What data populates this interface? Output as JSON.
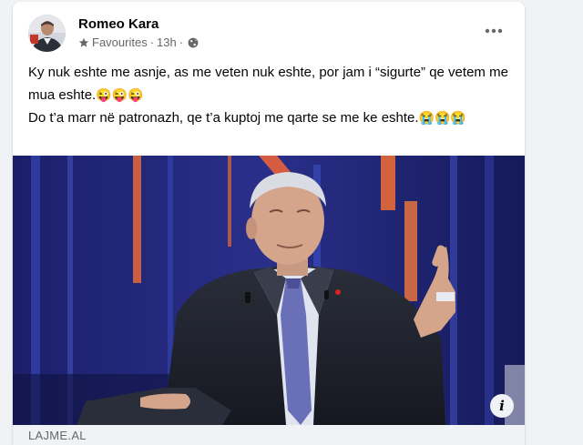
{
  "post": {
    "author": "Romeo Kara",
    "audience_label": "Favourites",
    "separator": "·",
    "time": "13h",
    "audience_icon": "star-icon",
    "privacy_icon": "globe-icon",
    "menu_icon": "more-options-icon",
    "text_line1": "Ky nuk eshte me asnje, as me veten nuk eshte, por jam i “sigurte” qe vetem me mua eshte.",
    "text_line1_emoji": "😜😜😜",
    "text_line2": "Do t’a marr në patronazh, qe t’a kuptoj me qarte se me ke eshte.",
    "text_line2_emoji": "😭😭😭"
  },
  "link_preview": {
    "domain": "LAJME.AL",
    "info_label": "i",
    "info_icon": "info-icon"
  },
  "colors": {
    "background": "#f0f2f5",
    "card": "#ffffff",
    "primary_text": "#050505",
    "secondary_text": "#65676b"
  }
}
